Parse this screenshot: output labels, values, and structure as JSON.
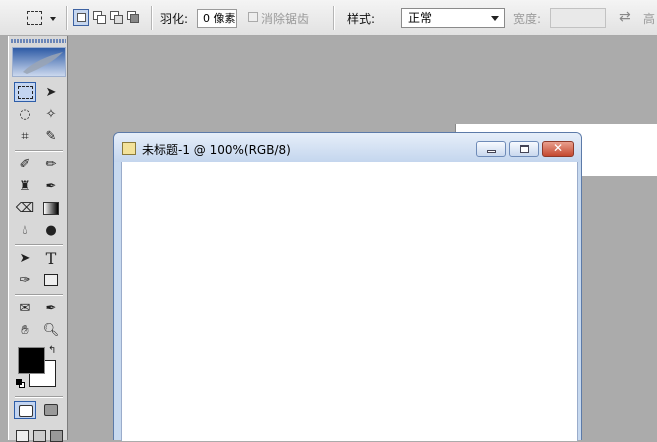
{
  "options_bar": {
    "feather_label": "羽化:",
    "feather_value": "0 像素",
    "antialias_label": "消除锯齿",
    "style_label": "样式:",
    "style_value": "正常",
    "width_label": "宽度:"
  },
  "document": {
    "title": "未标题-1 @ 100%(RGB/8)"
  },
  "toolbox": {
    "type_tool_glyph": "T"
  },
  "colors": {
    "foreground": "#000000",
    "background": "#ffffff"
  }
}
